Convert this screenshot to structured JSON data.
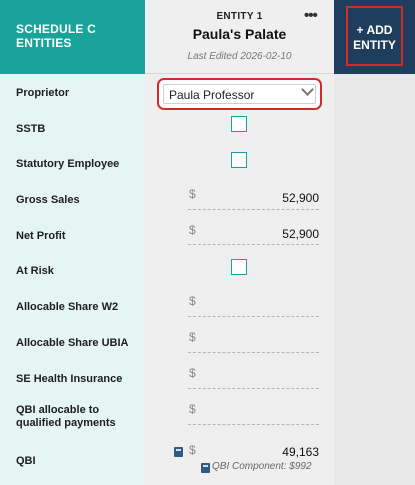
{
  "header": {
    "section_title": "SCHEDULE C ENTITIES",
    "entity_label": "ENTITY 1",
    "entity_name": "Paula's Palate",
    "last_edited": "Last Edited 2026-02-10",
    "more_glyph": "•••",
    "add_button": "+ ADD ENTITY"
  },
  "rows": {
    "proprietor": "Proprietor",
    "sstb": "SSTB",
    "statutory_employee": "Statutory Employee",
    "gross_sales": "Gross Sales",
    "net_profit": "Net Profit",
    "at_risk": "At Risk",
    "allocable_w2": "Allocable Share W2",
    "allocable_ubia": "Allocable Share UBIA",
    "se_health": "SE Health Insurance",
    "qbi_allocable": "QBI allocable to qualified payments",
    "qbi": "QBI"
  },
  "fields": {
    "proprietor_value": "Paula Professor",
    "sstb_checked": false,
    "statutory_employee_checked": false,
    "at_risk_checked": false,
    "currency": "$",
    "gross_sales": "52,900",
    "net_profit": "52,900",
    "allocable_w2": "",
    "allocable_ubia": "",
    "se_health": "",
    "qbi_allocable": "",
    "qbi": "49,163",
    "qbi_component": "QBI Component: $992"
  },
  "colors": {
    "teal": "#1aa39a",
    "navy": "#1f3d5d",
    "highlight_red": "#d32a2a",
    "label_bg": "#e4f5f3"
  },
  "icons": {
    "more": "more-horizontal-icon",
    "dropdown": "chevron-down-icon",
    "calculator": "calculator-icon"
  }
}
